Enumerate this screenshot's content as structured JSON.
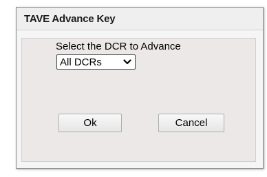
{
  "dialog": {
    "title": "TAVE Advance Key",
    "prompt": "Select the DCR to Advance",
    "dcr_select": {
      "selected": "All DCRs",
      "icon": "chevron-down-icon"
    },
    "buttons": {
      "ok_label": "Ok",
      "cancel_label": "Cancel"
    }
  }
}
